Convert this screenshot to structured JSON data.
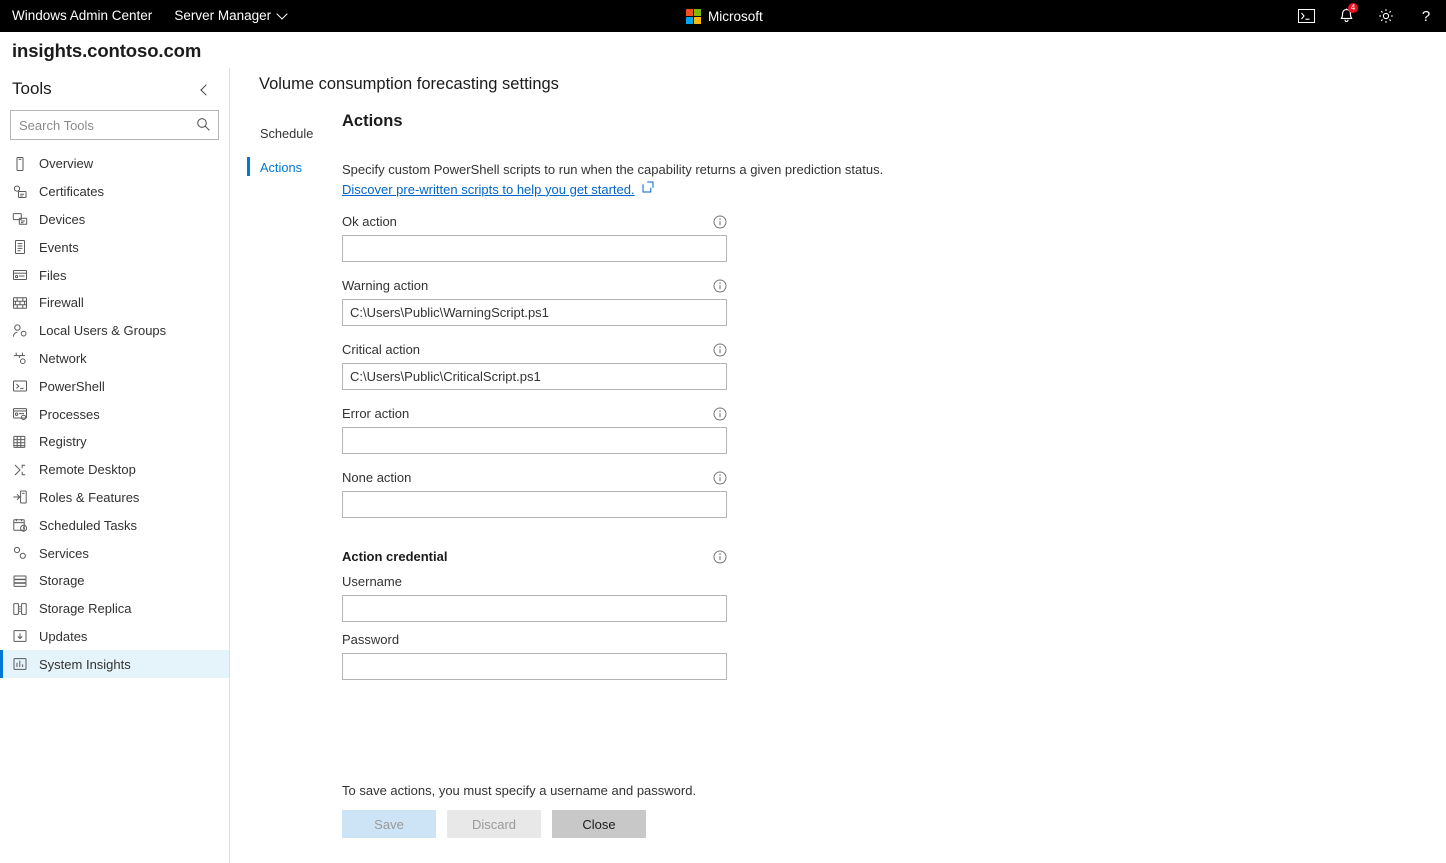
{
  "topbar": {
    "app_title": "Windows Admin Center",
    "solution": "Server Manager",
    "solution_chevron_icon": "chevron-down-icon",
    "brand": "Microsoft",
    "brand_colors": {
      "red": "#f25022",
      "green": "#7fba00",
      "blue": "#00a4ef",
      "yellow": "#ffb900"
    },
    "actions": [
      {
        "name": "powershell-console-icon",
        "label": ""
      },
      {
        "name": "notifications-bell-icon",
        "label": "",
        "badge": "4"
      },
      {
        "name": "settings-gear-icon",
        "label": ""
      },
      {
        "name": "help-question-icon",
        "label": ""
      }
    ]
  },
  "hostname": "insights.contoso.com",
  "sidebar": {
    "title": "Tools",
    "collapse_icon": "chevron-left-icon",
    "search": {
      "placeholder": "Search Tools",
      "value": "",
      "icon": "search-icon"
    },
    "items": [
      {
        "label": "Overview",
        "icon": "overview-icon",
        "selected": false
      },
      {
        "label": "Certificates",
        "icon": "certificates-icon",
        "selected": false
      },
      {
        "label": "Devices",
        "icon": "devices-icon",
        "selected": false
      },
      {
        "label": "Events",
        "icon": "events-icon",
        "selected": false
      },
      {
        "label": "Files",
        "icon": "files-icon",
        "selected": false
      },
      {
        "label": "Firewall",
        "icon": "firewall-icon",
        "selected": false
      },
      {
        "label": "Local Users & Groups",
        "icon": "users-groups-icon",
        "selected": false
      },
      {
        "label": "Network",
        "icon": "network-icon",
        "selected": false
      },
      {
        "label": "PowerShell",
        "icon": "powershell-icon",
        "selected": false
      },
      {
        "label": "Processes",
        "icon": "processes-icon",
        "selected": false
      },
      {
        "label": "Registry",
        "icon": "registry-icon",
        "selected": false
      },
      {
        "label": "Remote Desktop",
        "icon": "remote-desktop-icon",
        "selected": false
      },
      {
        "label": "Roles & Features",
        "icon": "roles-features-icon",
        "selected": false
      },
      {
        "label": "Scheduled Tasks",
        "icon": "scheduled-tasks-icon",
        "selected": false
      },
      {
        "label": "Services",
        "icon": "services-icon",
        "selected": false
      },
      {
        "label": "Storage",
        "icon": "storage-icon",
        "selected": false
      },
      {
        "label": "Storage Replica",
        "icon": "storage-replica-icon",
        "selected": false
      },
      {
        "label": "Updates",
        "icon": "updates-icon",
        "selected": false
      },
      {
        "label": "System Insights",
        "icon": "system-insights-icon",
        "selected": true
      }
    ],
    "selected_accent_color": "#0078d4",
    "selected_background_color": "#e5f3fb"
  },
  "main": {
    "page_title": "Volume consumption forecasting settings",
    "tabs": [
      {
        "label": "Schedule",
        "active": false
      },
      {
        "label": "Actions",
        "active": true
      }
    ],
    "panel": {
      "heading": "Actions",
      "description": "Specify custom PowerShell scripts to run when the capability returns a given prediction status.",
      "link_text": "Discover pre-written scripts to help you get started.",
      "link_icon": "open-in-new-icon",
      "link_color": "#0066cc",
      "fields": [
        {
          "label": "Ok action",
          "value": "",
          "info_icon": "info-icon"
        },
        {
          "label": "Warning action",
          "value": "C:\\Users\\Public\\WarningScript.ps1",
          "info_icon": "info-icon"
        },
        {
          "label": "Critical action",
          "value": "C:\\Users\\Public\\CriticalScript.ps1",
          "info_icon": "info-icon"
        },
        {
          "label": "Error action",
          "value": "",
          "info_icon": "info-icon"
        },
        {
          "label": "None action",
          "value": "",
          "info_icon": "info-icon"
        }
      ],
      "credential": {
        "heading": "Action credential",
        "info_icon": "info-icon",
        "username_label": "Username",
        "username_value": "",
        "password_label": "Password",
        "password_value": ""
      }
    },
    "footer": {
      "note": "To save actions, you must specify a username and password.",
      "buttons": [
        {
          "label": "Save",
          "state": "disabled",
          "color": "#cce4f6"
        },
        {
          "label": "Discard",
          "state": "disabled",
          "color": "#e8e8e8"
        },
        {
          "label": "Close",
          "state": "enabled",
          "color": "#c8c8c8"
        }
      ]
    }
  }
}
